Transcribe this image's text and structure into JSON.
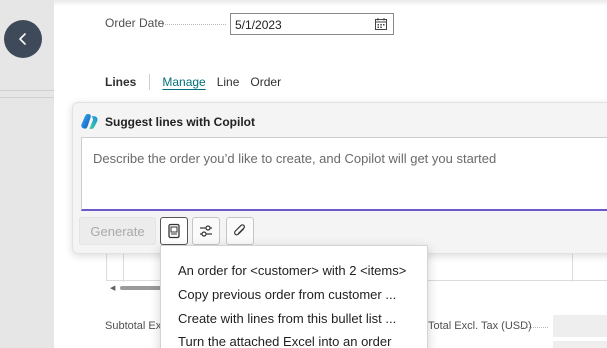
{
  "order_date": {
    "label": "Order Date",
    "value": "5/1/2023"
  },
  "lines": {
    "title": "Lines",
    "tabs": [
      {
        "label": "Manage",
        "active": true
      },
      {
        "label": "Line",
        "active": false
      },
      {
        "label": "Order",
        "active": false
      }
    ]
  },
  "copilot": {
    "title": "Suggest lines with Copilot",
    "placeholder": "Describe the order you’d like to create, and Copilot will get you started",
    "generate_label": "Generate",
    "tools": [
      "document-icon",
      "settings-sliders-icon",
      "paperclip-icon"
    ]
  },
  "dropdown": {
    "items": [
      "An order for <customer> with 2 <items>",
      "Copy previous order from customer ...",
      "Create with lines from this bullet list ...",
      "Turn the attached Excel into an order"
    ]
  },
  "totals": {
    "subtotal_label": "Subtotal Exc",
    "total_label": "Total Excl. Tax (USD)"
  },
  "colors": {
    "accent": "#00707a",
    "prompt_underline": "#6a5acd",
    "back_button": "#3e4a59"
  }
}
